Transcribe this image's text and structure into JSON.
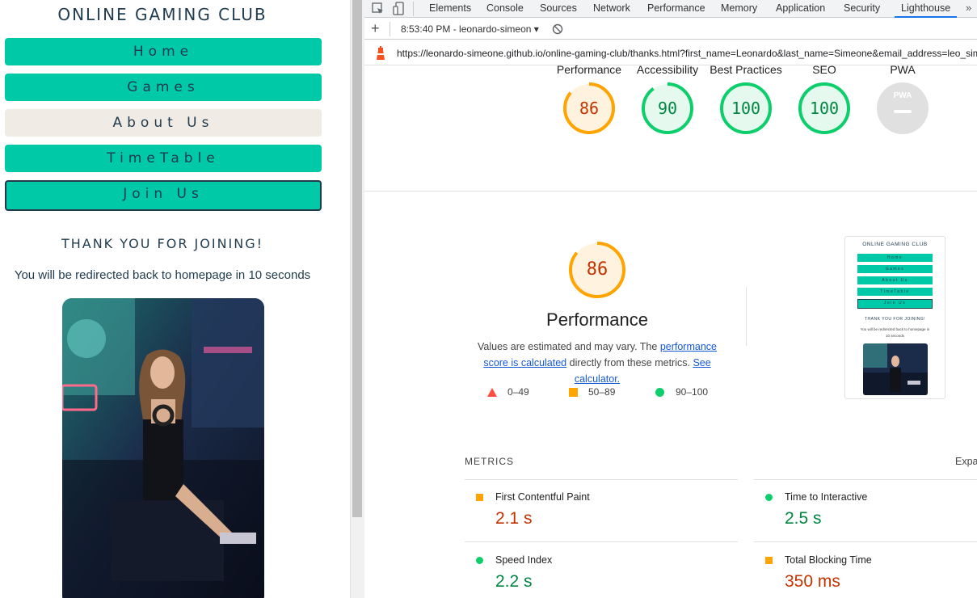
{
  "site": {
    "title": "ONLINE GAMING CLUB",
    "nav": [
      "Home",
      "Games",
      "About Us",
      "TimeTable",
      "Join Us"
    ],
    "thanks_title": "THANK YOU FOR JOINING!",
    "redirect_text": "You will be redirected back to homepage in 10 seconds"
  },
  "devtools": {
    "tabs": [
      "Elements",
      "Console",
      "Sources",
      "Network",
      "Performance",
      "Memory",
      "Application",
      "Security",
      "Lighthouse"
    ],
    "active_tab": "Lighthouse",
    "more_label": "»",
    "add_label": "+",
    "session": "8:53:40 PM - leonardo-simeon",
    "url": "https://leonardo-simeone.github.io/online-gaming-club/thanks.html?first_name=Leonardo&last_name=Simeone&email_address=leo_simeone@hotmail.com"
  },
  "lighthouse": {
    "scores": [
      {
        "label": "Performance",
        "value": "86",
        "status": "average"
      },
      {
        "label": "Accessibility",
        "value": "90",
        "status": "pass"
      },
      {
        "label": "Best Practices",
        "value": "100",
        "status": "pass"
      },
      {
        "label": "SEO",
        "value": "100",
        "status": "pass"
      },
      {
        "label": "PWA",
        "value": "PWA",
        "status": "na"
      }
    ],
    "performance": {
      "score": "86",
      "label": "Performance",
      "desc_pre": "Values are estimated and may vary. The ",
      "desc_link1": "performance score is calculated",
      "desc_mid": " directly from these metrics. ",
      "desc_link2": "See calculator."
    },
    "legend": [
      "0–49",
      "50–89",
      "90–100"
    ],
    "thumbnail": {
      "title": "ONLINE GAMING CLUB",
      "nav": [
        "Home",
        "Games",
        "About Us",
        "TimeTable",
        "Join Us"
      ],
      "thanks": "THANK YOU FOR JOINING!",
      "redirect": "You will be redirected back to homepage in 10 seconds"
    },
    "metrics_header": "METRICS",
    "expand_label": "Expand view",
    "metrics": [
      {
        "name": "First Contentful Paint",
        "value": "2.1 s",
        "status": "average"
      },
      {
        "name": "Time to Interactive",
        "value": "2.5 s",
        "status": "pass"
      },
      {
        "name": "Speed Index",
        "value": "2.2 s",
        "status": "pass"
      },
      {
        "name": "Total Blocking Time",
        "value": "350 ms",
        "status": "average"
      }
    ]
  },
  "colors": {
    "teal": "#00c9a7",
    "navy": "#1f3b4d",
    "beige": "#f1ebe5",
    "average": "#ffa400",
    "pass": "#0cce6b",
    "fail": "#ff4e42"
  }
}
